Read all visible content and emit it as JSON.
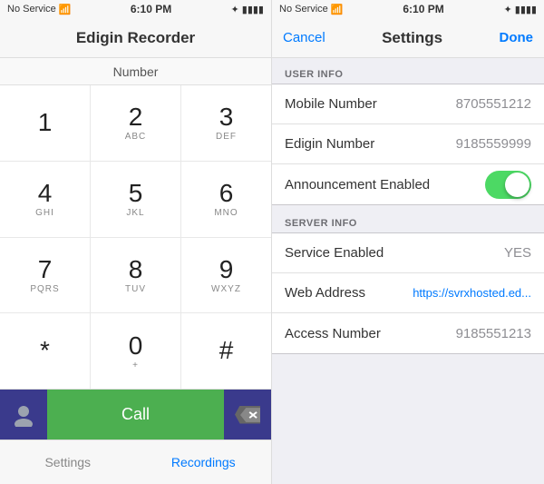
{
  "left": {
    "statusBar": {
      "noService": "No Service",
      "wifi": "WiFi",
      "time": "6:10 PM",
      "bluetooth": "BT",
      "battery": "Battery"
    },
    "appTitle": "Edigin Recorder",
    "numberLabel": "Number",
    "dialpad": [
      {
        "num": "1",
        "letters": ""
      },
      {
        "num": "2",
        "letters": "ABC"
      },
      {
        "num": "3",
        "letters": "DEF"
      },
      {
        "num": "4",
        "letters": "GHI"
      },
      {
        "num": "5",
        "letters": "JKL"
      },
      {
        "num": "6",
        "letters": "MNO"
      },
      {
        "num": "7",
        "letters": "PQRS"
      },
      {
        "num": "8",
        "letters": "TUV"
      },
      {
        "num": "9",
        "letters": "WXYZ"
      },
      {
        "num": "*",
        "letters": ""
      },
      {
        "num": "0",
        "letters": "+"
      },
      {
        "num": "#",
        "letters": ""
      }
    ],
    "callLabel": "Call",
    "tabs": [
      {
        "label": "Settings",
        "active": false
      },
      {
        "label": "Recordings",
        "active": true
      }
    ]
  },
  "right": {
    "statusBar": {
      "noService": "No Service",
      "wifi": "WiFi",
      "time": "6:10 PM",
      "bluetooth": "BT",
      "battery": "Battery"
    },
    "nav": {
      "cancel": "Cancel",
      "title": "Settings",
      "done": "Done"
    },
    "sections": [
      {
        "header": "USER INFO",
        "rows": [
          {
            "label": "Mobile Number",
            "value": "8705551212",
            "type": "text"
          },
          {
            "label": "Edigin Number",
            "value": "9185559999",
            "type": "text"
          },
          {
            "label": "Announcement Enabled",
            "value": "",
            "type": "toggle"
          }
        ]
      },
      {
        "header": "SERVER INFO",
        "rows": [
          {
            "label": "Service Enabled",
            "value": "YES",
            "type": "text"
          },
          {
            "label": "Web Address",
            "value": "https://svrxhosted.ed...",
            "type": "blue"
          },
          {
            "label": "Access Number",
            "value": "9185551213",
            "type": "text"
          }
        ]
      }
    ]
  }
}
